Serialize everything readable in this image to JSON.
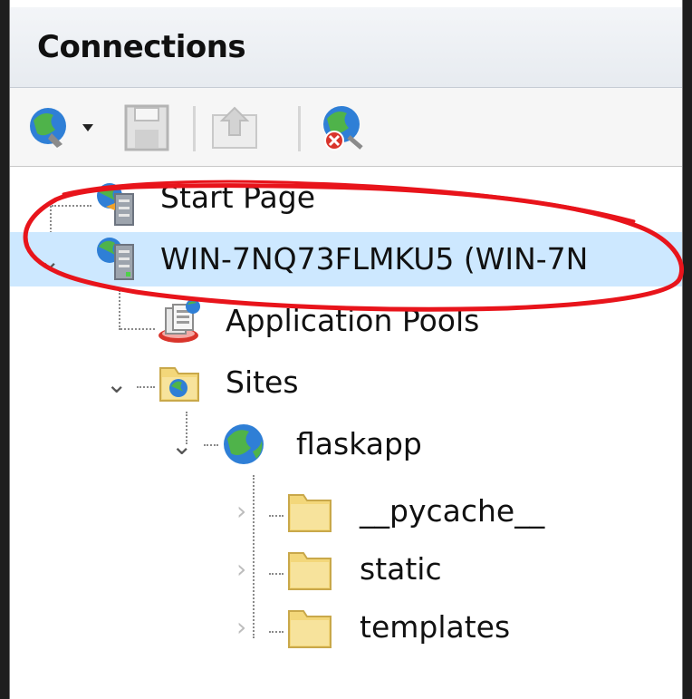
{
  "panel": {
    "title": "Connections"
  },
  "toolbar": {
    "items": [
      {
        "name": "connect-globe",
        "icon": "globe-connect-icon",
        "has_dropdown": true
      },
      {
        "name": "save",
        "icon": "save-icon"
      },
      {
        "name": "up",
        "icon": "up-folder-icon"
      },
      {
        "name": "disconnect",
        "icon": "globe-disconnect-icon"
      }
    ]
  },
  "tree": {
    "nodes": [
      {
        "label": "Start Page",
        "icon": "start-page-icon",
        "expander": "none"
      },
      {
        "label": "WIN-7NQ73FLMKU5 (WIN-7N",
        "icon": "server-icon",
        "expander": "expanded",
        "selected": true
      },
      {
        "label": "Application Pools",
        "icon": "app-pools-icon",
        "expander": "none"
      },
      {
        "label": "Sites",
        "icon": "sites-folder-icon",
        "expander": "expanded"
      },
      {
        "label": "flaskapp",
        "icon": "globe-icon",
        "expander": "expanded"
      },
      {
        "label": "__pycache__",
        "icon": "folder-icon",
        "expander": "collapsed"
      },
      {
        "label": "static",
        "icon": "folder-icon",
        "expander": "collapsed"
      },
      {
        "label": "templates",
        "icon": "folder-icon",
        "expander": "collapsed"
      }
    ]
  },
  "colors": {
    "selection": "#cde8ff",
    "annotation": "#e8141b",
    "folder": "#f3d77a"
  }
}
